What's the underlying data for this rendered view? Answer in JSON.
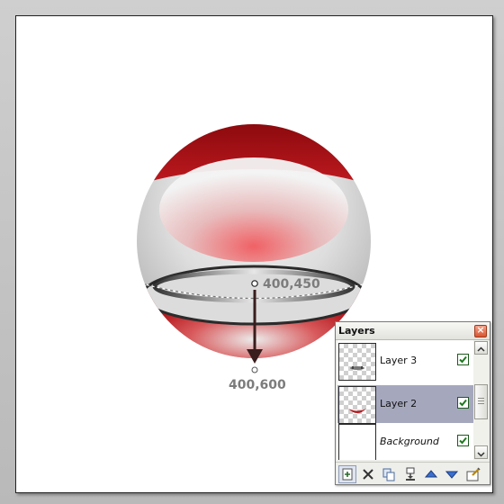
{
  "canvas": {
    "annotations": {
      "start_label": "400,450",
      "end_label": "400,600"
    }
  },
  "layers_panel": {
    "title": "Layers",
    "layers": [
      {
        "name": "Layer 3",
        "visible": true,
        "selected": false,
        "italic": false
      },
      {
        "name": "Layer 2",
        "visible": true,
        "selected": true,
        "italic": false
      },
      {
        "name": "Background",
        "visible": true,
        "selected": false,
        "italic": true
      }
    ],
    "toolbar": [
      {
        "icon": "add-layer-icon"
      },
      {
        "icon": "delete-layer-icon"
      },
      {
        "icon": "duplicate-layer-icon"
      },
      {
        "icon": "merge-layer-down-icon"
      },
      {
        "icon": "move-layer-up-icon"
      },
      {
        "icon": "move-layer-down-icon"
      },
      {
        "icon": "layer-properties-icon"
      }
    ]
  },
  "colors": {
    "ball_red": "#b3181d",
    "selection": "#a5a8bd"
  }
}
